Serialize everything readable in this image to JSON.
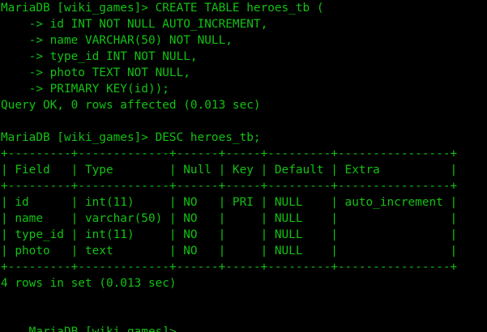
{
  "theme": {
    "background": "#000000",
    "foreground": "#13c113"
  },
  "session": {
    "prompt": "MariaDB [wiki_games]>",
    "lines": [
      "MariaDB [wiki_games]> CREATE TABLE heroes_tb (",
      "    -> id INT NOT NULL AUTO_INCREMENT,",
      "    -> name VARCHAR(50) NOT NULL,",
      "    -> type_id INT NOT NULL,",
      "    -> photo TEXT NOT NULL,",
      "    -> PRIMARY KEY(id));",
      "Query OK, 0 rows affected (0.013 sec)",
      "",
      "MariaDB [wiki_games]> DESC heroes_tb;",
      "+---------+-------------+------+-----+---------+----------------+",
      "| Field   | Type        | Null | Key | Default | Extra          |",
      "+---------+-------------+------+-----+---------+----------------+",
      "| id      | int(11)     | NO   | PRI | NULL    | auto_increment |",
      "| name    | varchar(50) | NO   |     | NULL    |                |",
      "| type_id | int(11)     | NO   |     | NULL    |                |",
      "| photo   | text        | NO   |     | NULL    |                |",
      "+---------+-------------+------+-----+---------+----------------+",
      "4 rows in set (0.013 sec)",
      "",
      "MariaDB [wiki_games]>"
    ]
  }
}
